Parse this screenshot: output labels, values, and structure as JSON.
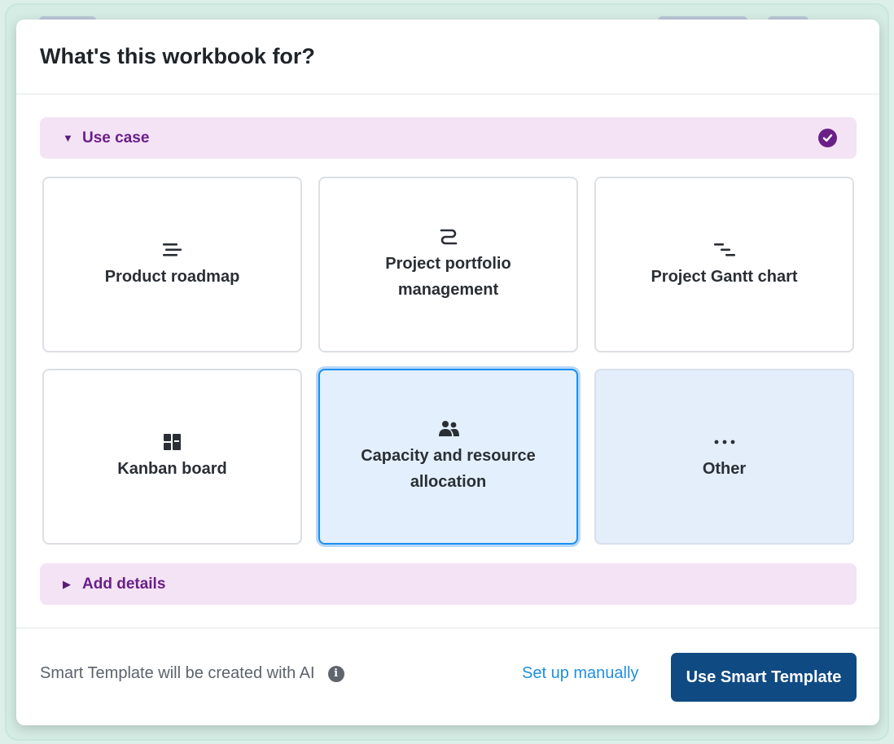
{
  "dialog": {
    "title": "What's this workbook for?"
  },
  "use_case_section": {
    "label": "Use case",
    "expanded": true,
    "completed": true
  },
  "options": [
    {
      "label": "Product roadmap",
      "icon": "roadmap-lines-icon",
      "selected": false
    },
    {
      "label": "Project portfolio management",
      "icon": "portfolio-path-icon",
      "selected": false
    },
    {
      "label": "Project Gantt chart",
      "icon": "gantt-bars-icon",
      "selected": false
    },
    {
      "label": "Kanban board",
      "icon": "kanban-columns-icon",
      "selected": false
    },
    {
      "label": "Capacity and resource allocation",
      "icon": "people-group-icon",
      "selected": true
    },
    {
      "label": "Other",
      "icon": "ellipsis-icon",
      "selected": false
    }
  ],
  "details_section": {
    "label": "Add details",
    "expanded": false
  },
  "footer": {
    "note": "Smart Template will be created with AI",
    "info_icon": "info-icon",
    "manual_link": "Set up manually",
    "primary_button": "Use Smart Template"
  },
  "colors": {
    "accent_purple": "#6a1f88",
    "section_bg": "#f3e3f4",
    "selected_border": "#1c8ff0",
    "selected_bg": "#e3effc",
    "primary_button": "#0f4a82",
    "link": "#1f8fe0"
  }
}
